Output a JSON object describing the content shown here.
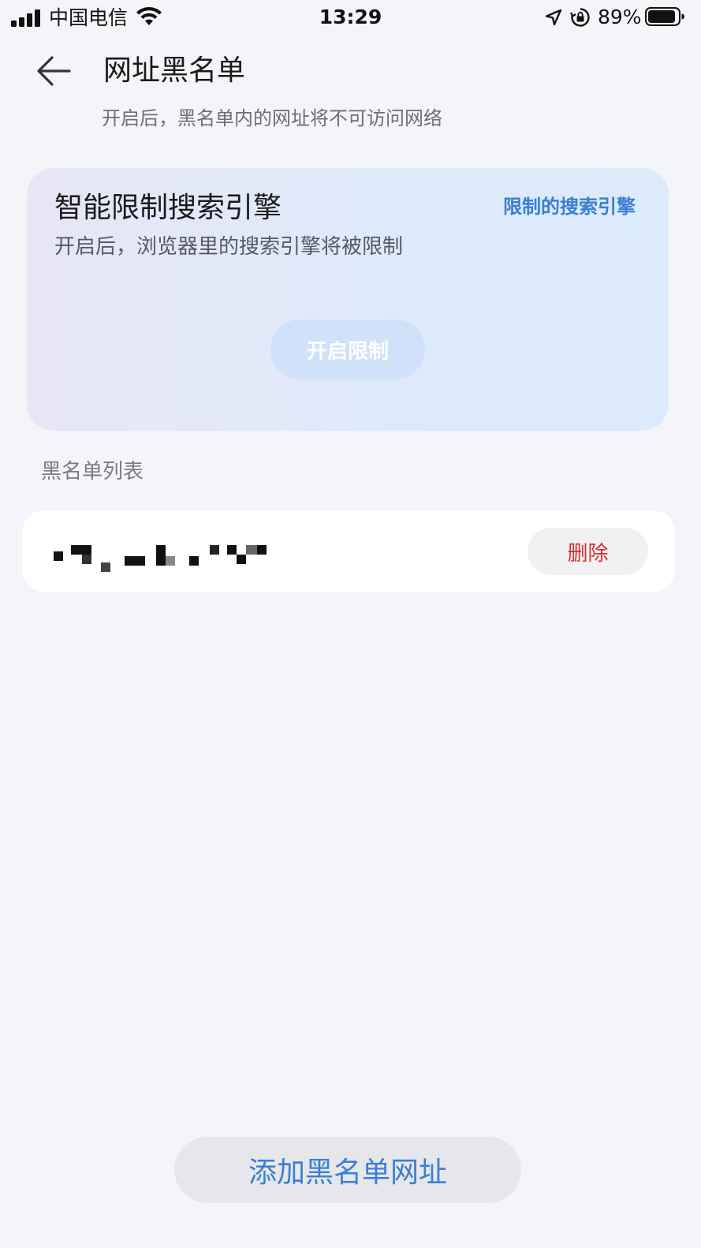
{
  "status_bar": {
    "carrier": "中国电信",
    "time": "13:29",
    "battery": "89%",
    "icons": [
      "signal-icon",
      "wifi-icon",
      "location-icon",
      "orientation-lock-icon",
      "battery-icon"
    ]
  },
  "header": {
    "title": "网址黑名单",
    "subtitle": "开启后，黑名单内的网址将不可访问网络",
    "back_icon": "back-arrow-icon"
  },
  "smart_card": {
    "title": "智能限制搜索引擎",
    "description": "开启后，浏览器里的搜索引擎将被限制",
    "link": "限制的搜索引擎",
    "button": "开启限制",
    "button_color": "#cfe2fa",
    "link_color": "#3b7fd0"
  },
  "blacklist": {
    "section_label": "黑名单列表",
    "items": [
      {
        "url": "",
        "delete_label": "删除"
      }
    ],
    "delete_color": "#d2322d"
  },
  "footer": {
    "add_button": "添加黑名单网址",
    "accent": "#3b7fd0"
  }
}
